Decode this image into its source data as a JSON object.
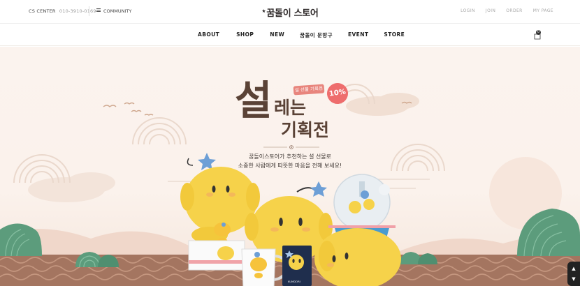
{
  "header": {
    "cs_label": "CS CENTER",
    "cs_phone": "010-3910-0169",
    "community": "COMMUNITY",
    "logo": "꿈돌이 스토어",
    "links": [
      "LOGIN",
      "JOIN",
      "ORDER",
      "MY PAGE"
    ]
  },
  "nav": {
    "items": [
      "ABOUT",
      "SHOP",
      "NEW",
      "꿈돌이 문방구",
      "EVENT",
      "STORE"
    ],
    "cart_count": "0"
  },
  "hero": {
    "badge": "설 선물 기획전",
    "discount": "10%",
    "title_big": "설",
    "title_line1": "레는",
    "title_line2": "기획전",
    "subtitle_line1": "꿈돌이스토어가 추천하는 설 선물로",
    "subtitle_line2": "소중한 사람에게 따뜻한 마음을 전해 보세요!",
    "box_label": "KUMDORI",
    "pouch_label": "KUMDORI"
  },
  "colors": {
    "accent": "#ee6d6d",
    "title_brown": "#5a4236",
    "hero_bg": "#fbf3ee",
    "wave_brown": "#9c6a52",
    "hill_green": "#5b9b7b",
    "plush_yellow": "#f6d24a"
  },
  "icons": {
    "menu": "hamburger-icon",
    "cart": "shopping-bag-icon",
    "scroll_up": "chevron-up-icon",
    "scroll_down": "chevron-down-icon"
  }
}
